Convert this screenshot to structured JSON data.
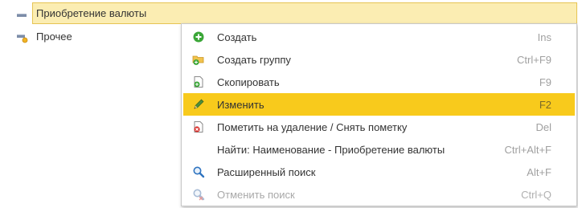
{
  "tree": {
    "rows": [
      {
        "label": "Приобретение валюты",
        "selected": true,
        "icon": "group-minus-icon"
      },
      {
        "label": "Прочее",
        "selected": false,
        "icon": "item-marked-icon"
      }
    ]
  },
  "context_menu": {
    "items": [
      {
        "label": "Создать",
        "shortcut": "Ins",
        "icon": "plus-circle-icon"
      },
      {
        "label": "Создать группу",
        "shortcut": "Ctrl+F9",
        "icon": "folder-add-icon"
      },
      {
        "label": "Скопировать",
        "shortcut": "F9",
        "icon": "copy-icon"
      },
      {
        "label": "Изменить",
        "shortcut": "F2",
        "icon": "pencil-icon",
        "active": true
      },
      {
        "label": "Пометить на удаление / Снять пометку",
        "shortcut": "Del",
        "icon": "delete-mark-icon"
      },
      {
        "label": "Найти: Наименование - Приобретение валюты",
        "shortcut": "Ctrl+Alt+F",
        "icon": ""
      },
      {
        "label": "Расширенный поиск",
        "shortcut": "Alt+F",
        "icon": "search-icon"
      },
      {
        "label": "Отменить поиск",
        "shortcut": "Ctrl+Q",
        "icon": "cancel-search-icon",
        "disabled": true
      }
    ]
  },
  "colors": {
    "selection_fill": "#fbedb2",
    "selection_border": "#e6c453",
    "menu_active": "#f8ca1c",
    "icon_green": "#3aa637",
    "icon_red": "#d9302c",
    "icon_blue": "#2f74c0"
  }
}
